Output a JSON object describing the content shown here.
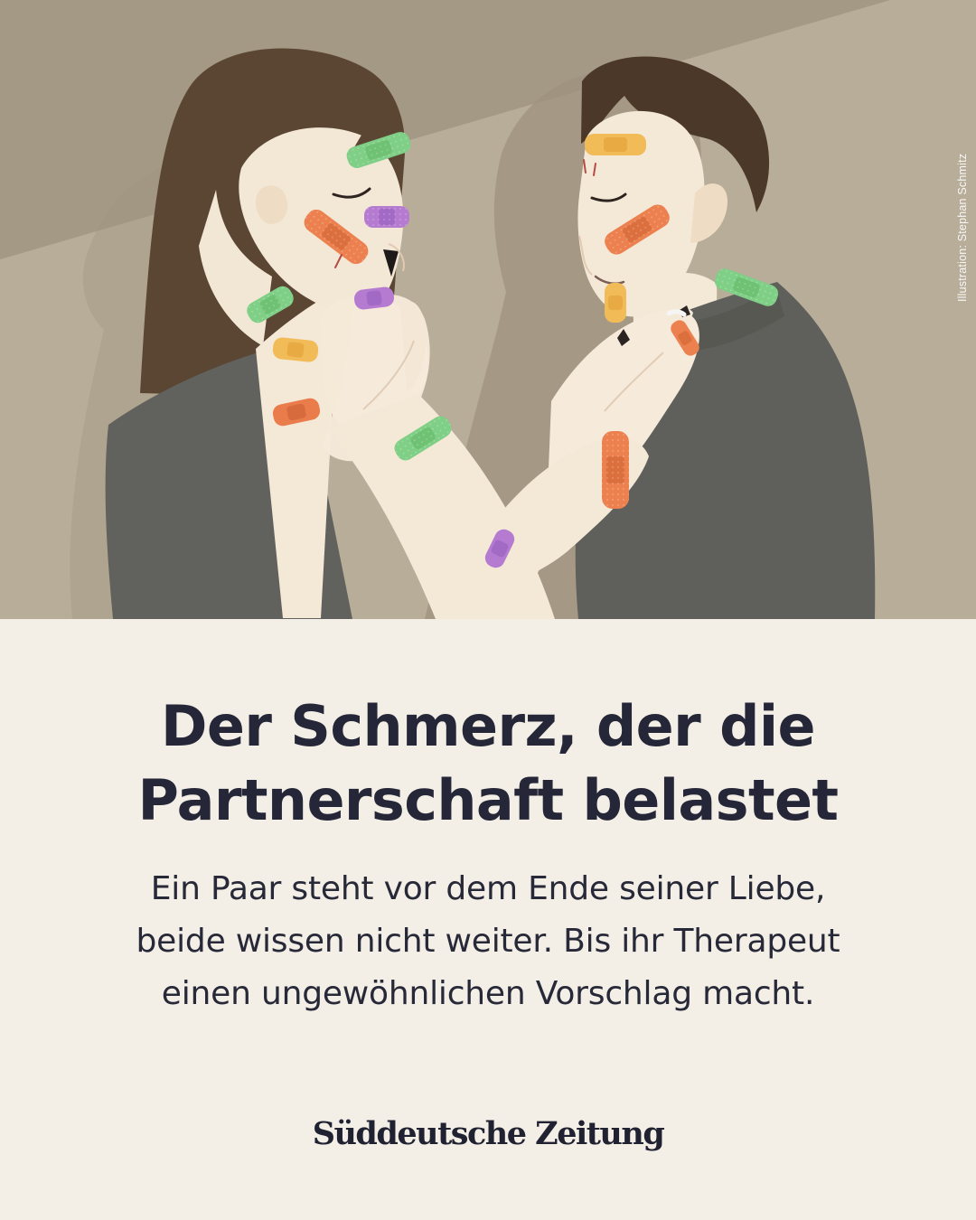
{
  "illustration": {
    "credit": "Illustration: Stephan Schmitz",
    "subject": "couple-with-plasters-illustration",
    "colors": {
      "wall": "#b4aa96",
      "wall_shadow": "#a69b86",
      "person_shadow": "#9f9380",
      "hair_woman": "#5c4734",
      "hair_man": "#4b3828",
      "skin": "#f5e9d7",
      "shirt": "#5f605b",
      "plaster_orange": "#ea7e4b",
      "plaster_green": "#7bcf83",
      "plaster_purple": "#b078cc",
      "plaster_yellow": "#f1bb55",
      "nails": "#2b2423"
    }
  },
  "headline": {
    "line1": "Der Schmerz, der die",
    "line2": "Partnerschaft belastet"
  },
  "dek": {
    "line1": "Ein Paar steht vor dem Ende seiner Liebe,",
    "line2": "beide wissen nicht weiter. Bis ihr Therapeut",
    "line3": "einen ungewöhnlichen Vorschlag macht."
  },
  "brand": {
    "name": "Süddeutsche Zeitung"
  },
  "colors": {
    "background": "#f3efe6",
    "headline": "#252637",
    "body": "#282938",
    "brand": "#202232"
  }
}
